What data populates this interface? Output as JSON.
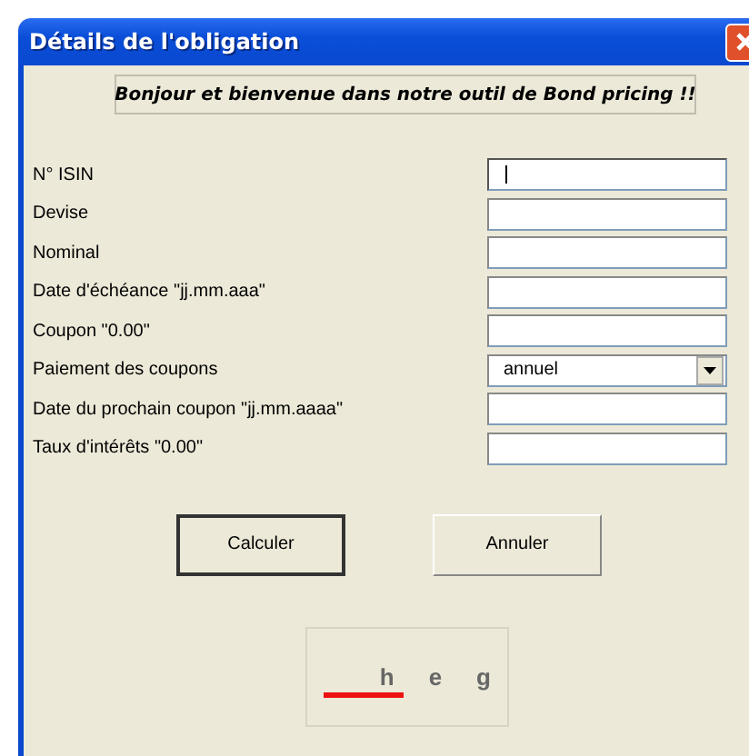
{
  "window": {
    "title": "Détails de l'obligation"
  },
  "banner": "Bonjour et bienvenue dans notre outil de Bond pricing !!",
  "fields": [
    {
      "label": "N° ISIN",
      "kind": "text",
      "focused": true
    },
    {
      "label": "Devise",
      "kind": "text",
      "focused": false
    },
    {
      "label": "Nominal",
      "kind": "text",
      "focused": false
    },
    {
      "label": "Date d'échéance \"jj.mm.aaa\"",
      "kind": "text",
      "focused": false
    },
    {
      "label": "Coupon \"0.00\"",
      "kind": "text",
      "focused": false
    },
    {
      "label": "Paiement des coupons",
      "kind": "combo",
      "value": "annuel",
      "focused": false
    },
    {
      "label": "Date du prochain coupon \"jj.mm.aaaa\"",
      "kind": "text",
      "focused": false
    },
    {
      "label": "Taux d'intérêts \"0.00\"",
      "kind": "text",
      "focused": false
    }
  ],
  "buttons": [
    {
      "label": "Calculer",
      "default": true
    },
    {
      "label": "Annuler",
      "default": false
    }
  ],
  "logo": {
    "letters": [
      "h",
      "e",
      "g"
    ]
  }
}
